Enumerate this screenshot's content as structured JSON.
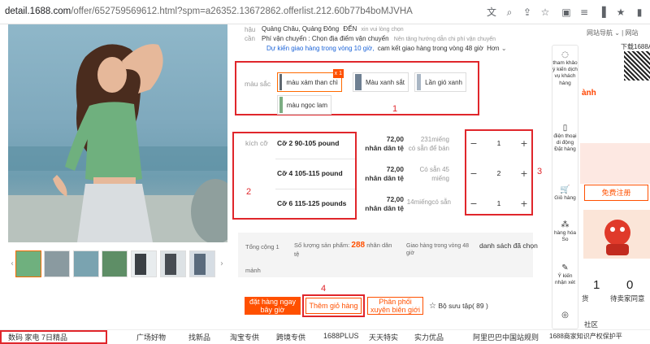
{
  "browser": {
    "url_host": "detail.1688.com",
    "url_path": "/offer/652759569612.html?spm=a26352.13672862.offerlist.212.60b77b4boMJVHA"
  },
  "origin": {
    "label": "hậu cần",
    "location": "Quảng Châu, Quảng Đông",
    "to": "ĐẾN",
    "choose": "xin vui lòng chọn",
    "shipping_fee_label": "Phí vận chuyển : Chọn địa điểm vận chuyển",
    "shipping_fee_hint": "Nên tăng hướng dẫn chi phí vận chuyển",
    "delivery_expected": "Dự kiến giao hàng trong vòng 10 giờ,",
    "delivery_commit": "cam kết giao hàng trong vòng 48 giờ",
    "more": "Hơn"
  },
  "colors": {
    "label": "màu sắc",
    "items": [
      {
        "label": "màu xám than chì",
        "badge": "x 1"
      },
      {
        "label": "Màu xanh sắt"
      },
      {
        "label": "Lần gió xanh"
      },
      {
        "label": "màu ngọc lam"
      }
    ]
  },
  "sizes": {
    "label": "kích cỡ",
    "rows": [
      {
        "name": "Cỡ 2 90-105 pound",
        "price": "72,00",
        "unit": "nhân dân tệ",
        "stock": "231miếng",
        "stock2": "có sẵn để bán",
        "qty": "1"
      },
      {
        "name": "Cỡ 4 105-115 pound",
        "price": "72,00",
        "unit": "nhân dân tệ",
        "stock": "Có sẵn 45",
        "stock2": "miếng",
        "qty": "2"
      },
      {
        "name": "Cỡ 6 115-125 pounds",
        "price": "72,00",
        "unit": "nhân dân tệ",
        "stock": "14miếngcó sẵn",
        "stock2": "",
        "qty": "1"
      }
    ]
  },
  "annotations": {
    "n1": "1",
    "n2": "2",
    "n3": "3",
    "n4": "4"
  },
  "summary": {
    "total_label": "Tổng cộng 1",
    "total_unit": "mảnh",
    "product_qty_label": "Số lượng sản phẩm:",
    "product_qty_value": "288",
    "product_qty_unit": "nhân dân",
    "product_qty_unit2": "tệ",
    "ship_label": "Giao hàng trong vòng 48",
    "ship_label2": "giờ",
    "list_label": "danh sách đã chọn"
  },
  "actions": {
    "order_now": "đặt hàng ngay bây giờ",
    "add_cart": "Thêm giỏ hàng",
    "distribute": "Phân phối xuyên biên giới",
    "collection": "Bộ sưu tập( 89 )"
  },
  "toolbar": [
    {
      "icon": "question-icon",
      "label": "tham khảo ý kiến dịch vụ khách hàng"
    },
    {
      "icon": "phone-icon",
      "label": "điện thoại di động Đặt hàng"
    },
    {
      "icon": "cart-icon",
      "label": "Giỏ hàng"
    },
    {
      "icon": "goods-icon",
      "label": "hàng hóa So"
    },
    {
      "icon": "feedback-icon",
      "label": "Ý kiến nhận xét"
    }
  ],
  "right_panel": {
    "nav": "网站导航",
    "nav2": "网站",
    "download": "下载1688A",
    "red_text": "ành",
    "register": "免费注册",
    "num1": "1",
    "num2": "0",
    "label1": "货",
    "label2": "待卖家同意",
    "community": "社区"
  },
  "footer": {
    "left": "数码 家电 7日精品",
    "items": [
      "广场好物",
      "找新品",
      "淘宝专供",
      "跨境专供",
      "1688PLUS",
      "天天特实",
      "实力优品",
      "阿里巴巴中国站规则",
      "1688商家知识产权保护平"
    ]
  }
}
